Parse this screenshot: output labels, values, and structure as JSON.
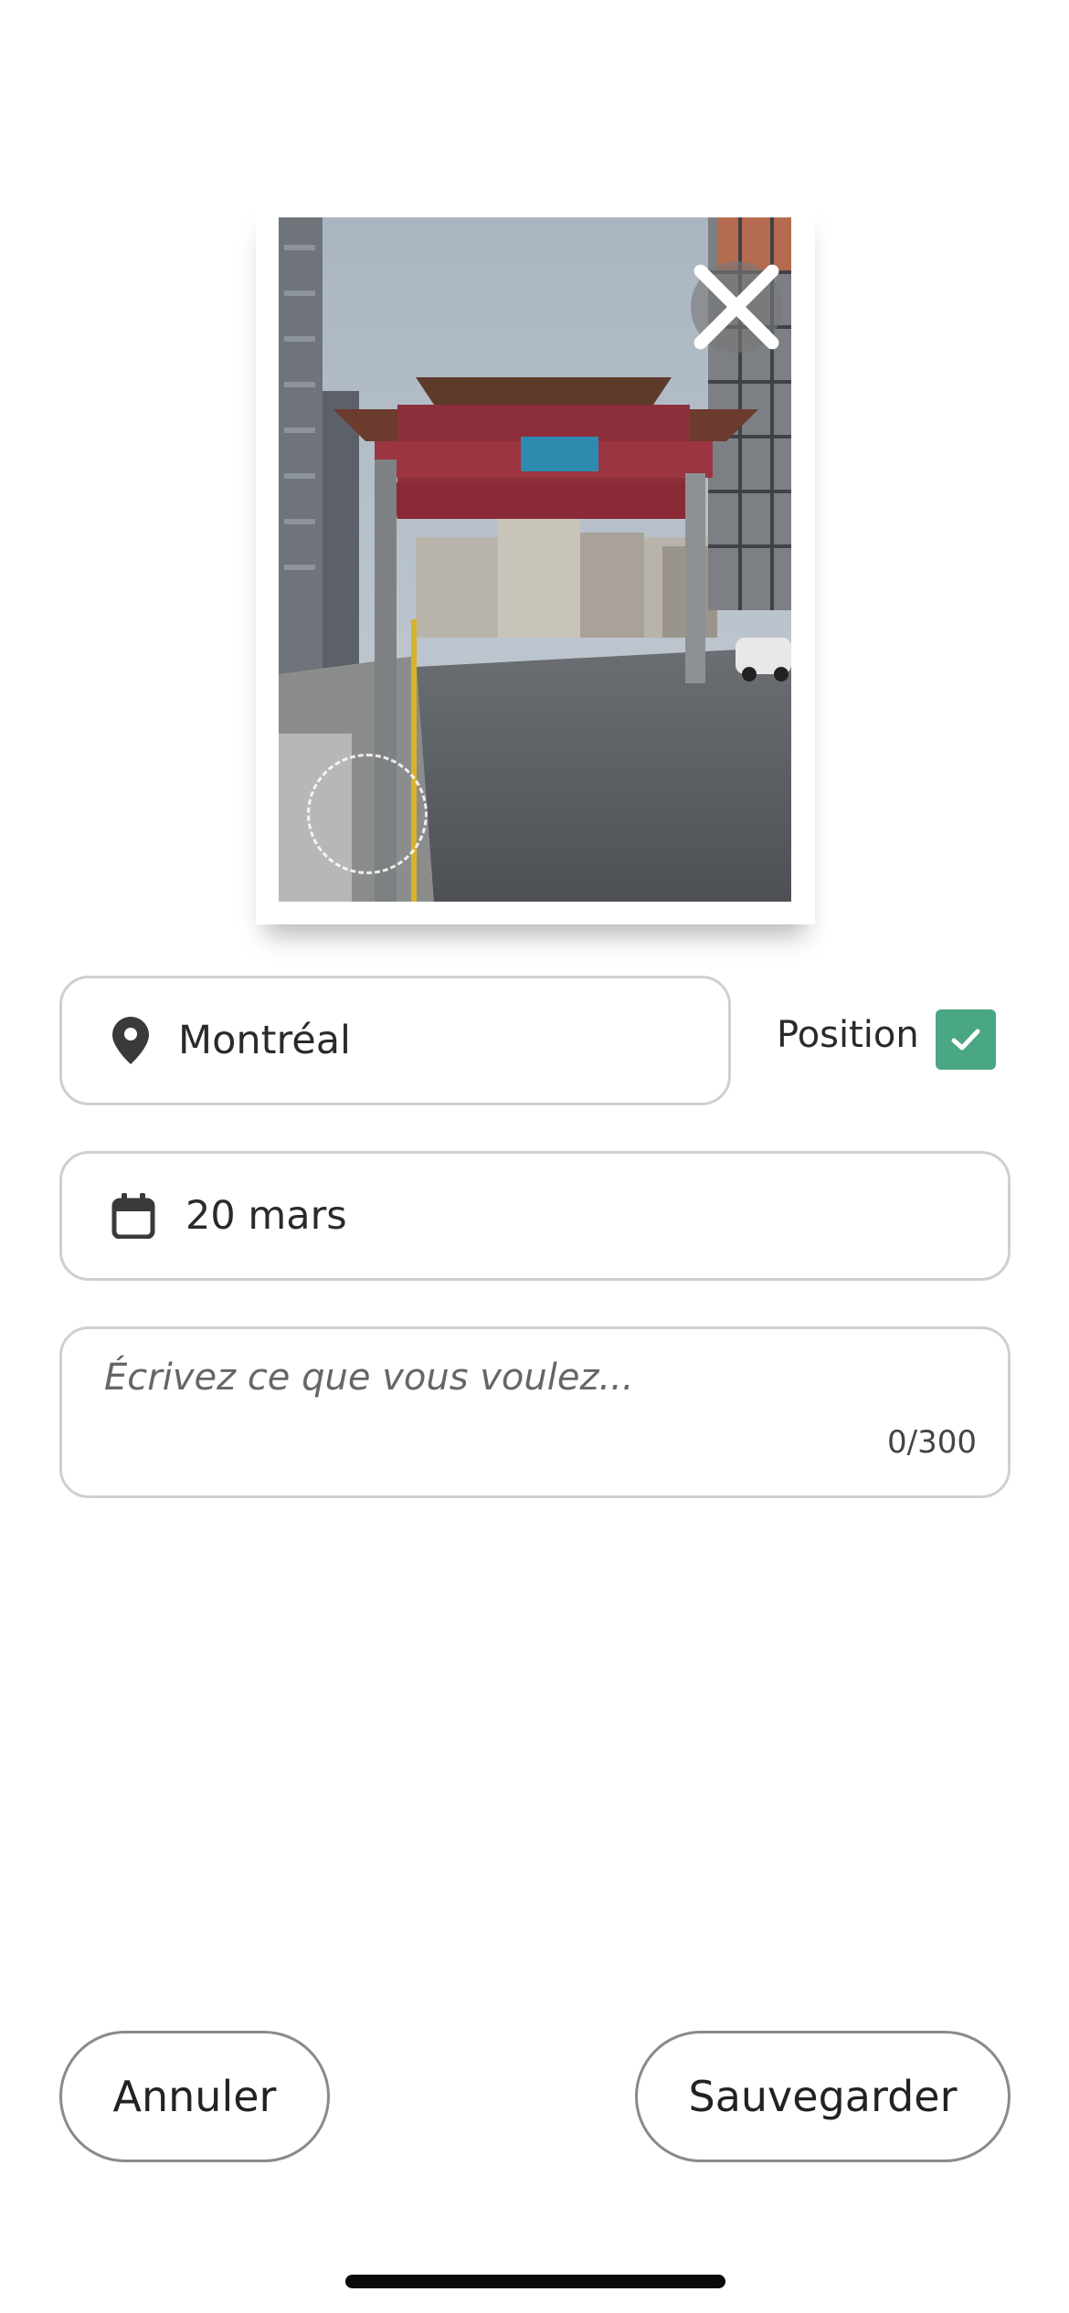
{
  "photo": {
    "close_icon": "close-icon",
    "description_icon": "photo-thumbnail"
  },
  "location": {
    "icon": "location-pin-icon",
    "value": "Montréal"
  },
  "position": {
    "label": "Position",
    "checked": true,
    "color": "#4aa783"
  },
  "date": {
    "icon": "calendar-icon",
    "value": "20 mars"
  },
  "note": {
    "placeholder": "Écrivez ce que vous voulez...",
    "counter": "0/300"
  },
  "actions": {
    "cancel_label": "Annuler",
    "save_label": "Sauvegarder"
  }
}
